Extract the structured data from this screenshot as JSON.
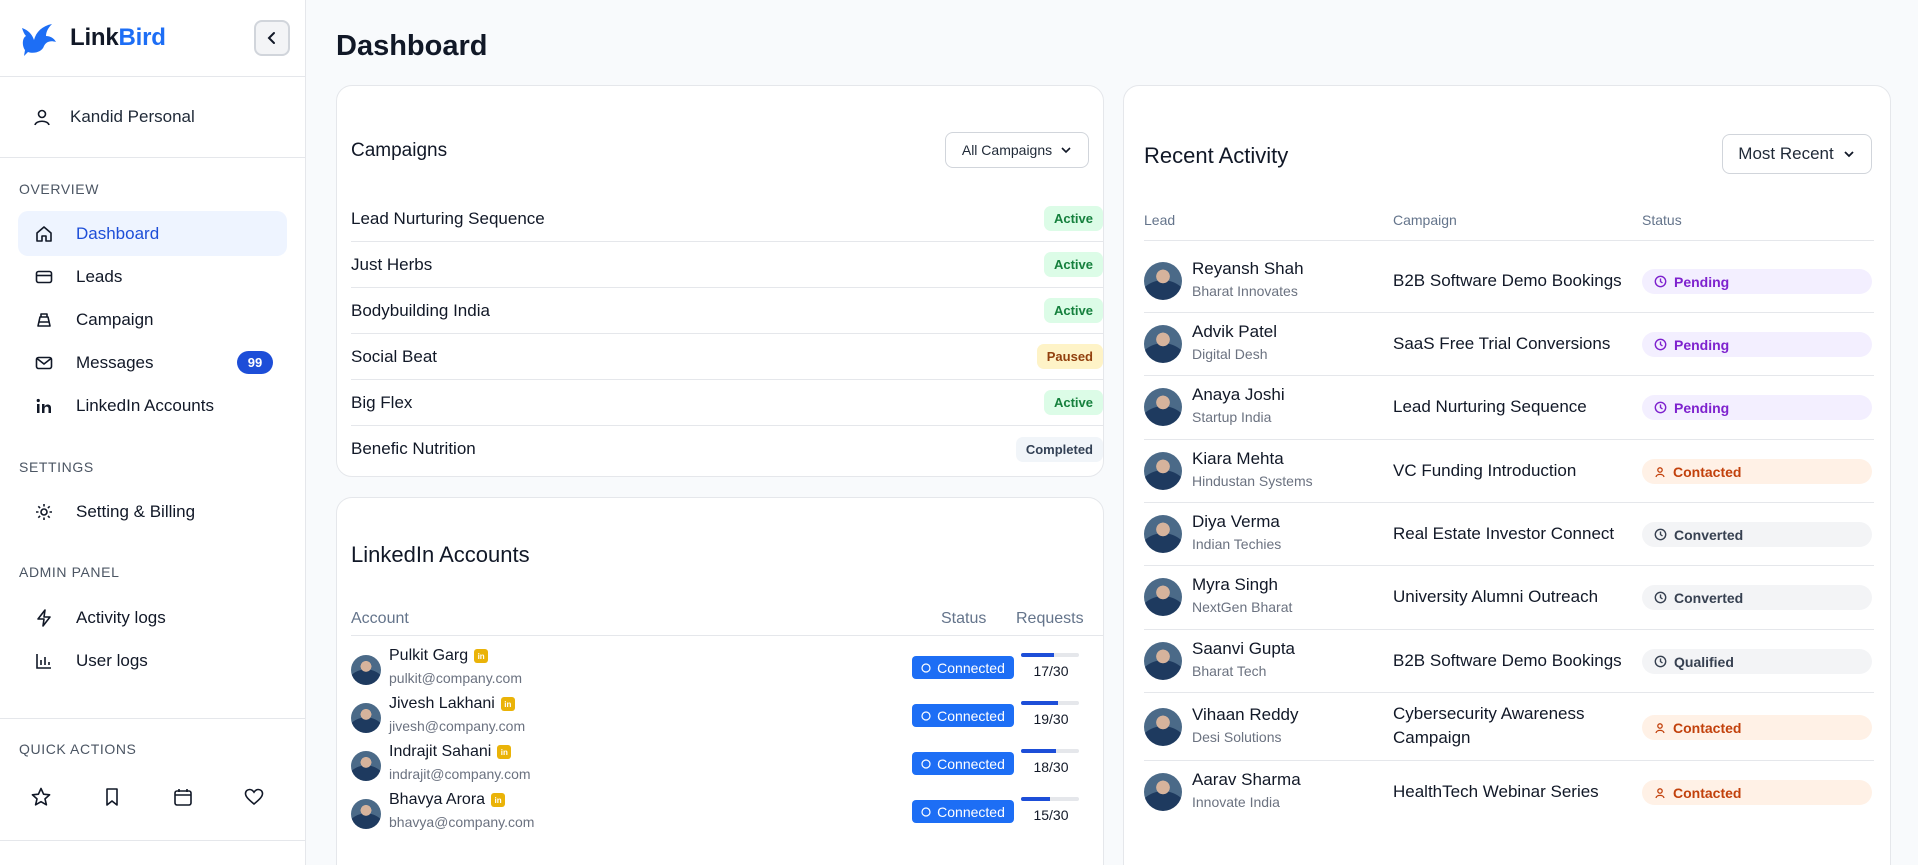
{
  "brand": {
    "name_part1": "Link",
    "name_part2": "Bird"
  },
  "sidebar": {
    "account_name": "Kandid Personal",
    "overview_title": "OVERVIEW",
    "overview_items": [
      {
        "label": "Dashboard",
        "icon": "home-icon",
        "active": true
      },
      {
        "label": "Leads",
        "icon": "card-icon"
      },
      {
        "label": "Campaign",
        "icon": "campaign-icon"
      },
      {
        "label": "Messages",
        "icon": "mail-icon",
        "badge": "99"
      },
      {
        "label": "LinkedIn Accounts",
        "icon": "linkedin-icon"
      }
    ],
    "settings_title": "SETTINGS",
    "settings_items": [
      {
        "label": "Setting & Billing",
        "icon": "gear-icon"
      }
    ],
    "admin_title": "ADMIN PANEL",
    "admin_items": [
      {
        "label": "Activity logs",
        "icon": "bolt-icon"
      },
      {
        "label": "User logs",
        "icon": "bar-chart-icon"
      }
    ],
    "quick_title": "QUICK ACTIONS",
    "quick_icons": [
      "star-icon",
      "bookmark-icon",
      "calendar-icon",
      "heart-icon"
    ]
  },
  "main": {
    "page_title": "Dashboard"
  },
  "campaigns": {
    "title": "Campaigns",
    "filter_label": "All Campaigns",
    "rows": [
      {
        "name": "Lead Nurturing Sequence",
        "status": "Active",
        "kind": "active"
      },
      {
        "name": "Just Herbs",
        "status": "Active",
        "kind": "active"
      },
      {
        "name": "Bodybuilding India",
        "status": "Active",
        "kind": "active"
      },
      {
        "name": "Social Beat",
        "status": "Paused",
        "kind": "paused"
      },
      {
        "name": "Big Flex",
        "status": "Active",
        "kind": "active"
      },
      {
        "name": "Benefic Nutrition",
        "status": "Completed",
        "kind": "completed"
      }
    ]
  },
  "linkedin": {
    "title": "LinkedIn Accounts",
    "col_account": "Account",
    "col_status": "Status",
    "col_requests": "Requests",
    "in_glyph": "in",
    "rows": [
      {
        "name": "Pulkit Garg",
        "email": "pulkit@company.com",
        "status": "Connected",
        "requests": "17/30",
        "progress": 0.57
      },
      {
        "name": "Jivesh Lakhani",
        "email": "jivesh@company.com",
        "status": "Connected",
        "requests": "19/30",
        "progress": 0.63
      },
      {
        "name": "Indrajit Sahani",
        "email": "indrajit@company.com",
        "status": "Connected",
        "requests": "18/30",
        "progress": 0.6
      },
      {
        "name": "Bhavya Arora",
        "email": "bhavya@company.com",
        "status": "Connected",
        "requests": "15/30",
        "progress": 0.5
      }
    ]
  },
  "activity": {
    "title": "Recent Activity",
    "sort_label": "Most Recent",
    "col_lead": "Lead",
    "col_campaign": "Campaign",
    "col_status": "Status",
    "rows": [
      {
        "name": "Reyansh Shah",
        "company": "Bharat Innovates",
        "campaign": "B2B Software Demo Bookings",
        "status": "Pending",
        "kind": "pending"
      },
      {
        "name": "Advik Patel",
        "company": "Digital Desh",
        "campaign": "SaaS Free Trial Conversions",
        "status": "Pending",
        "kind": "pending"
      },
      {
        "name": "Anaya Joshi",
        "company": "Startup India",
        "campaign": "Lead Nurturing Sequence",
        "status": "Pending",
        "kind": "pending"
      },
      {
        "name": "Kiara Mehta",
        "company": "Hindustan Systems",
        "campaign": "VC Funding Introduction",
        "status": "Contacted",
        "kind": "contacted"
      },
      {
        "name": "Diya Verma",
        "company": "Indian Techies",
        "campaign": "Real Estate Investor Connect",
        "status": "Converted",
        "kind": "converted"
      },
      {
        "name": "Myra Singh",
        "company": "NextGen Bharat",
        "campaign": "University Alumni Outreach",
        "status": "Converted",
        "kind": "converted"
      },
      {
        "name": "Saanvi Gupta",
        "company": "Bharat Tech",
        "campaign": "B2B Software Demo Bookings",
        "status": "Qualified",
        "kind": "qualified"
      },
      {
        "name": "Vihaan Reddy",
        "company": "Desi Solutions",
        "campaign": "Cybersecurity Awareness Campaign",
        "status": "Contacted",
        "kind": "contacted"
      },
      {
        "name": "Aarav Sharma",
        "company": "Innovate India",
        "campaign": "HealthTech Webinar Series",
        "status": "Contacted",
        "kind": "contacted"
      }
    ]
  },
  "colors": {
    "accent": "#1d6ef5",
    "accent_dark": "#1d4ed8",
    "active_bg": "#eef4ff"
  }
}
